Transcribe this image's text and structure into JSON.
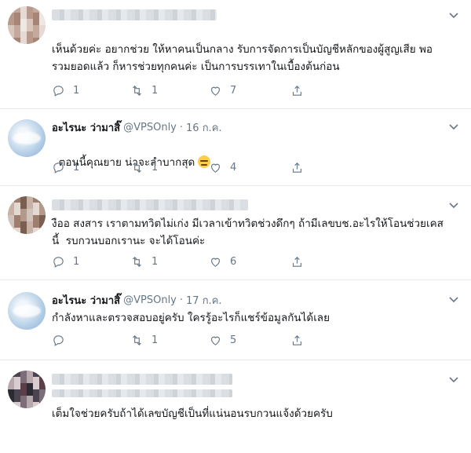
{
  "tweets": [
    {
      "display_name": "",
      "handle": "",
      "date": "",
      "text": "เห็นด้วยค่ะ อยากช่วย ให้หาคนเป็นกลาง รับการจัดการเป็นบัญชีหลักของผู้สูญเสีย พอ\nรวมยอดแล้ว ก็หารช่วยทุกคนค่ะ เป็นการบรรเทาในเบื้องต้นก่อน",
      "replies": "1",
      "retweets": "1",
      "likes": "7"
    },
    {
      "display_name": "อะไรนะ ว่ามาสิ๊",
      "handle": "@VPSOnly",
      "dot": "·",
      "date": "16 ก.ค.",
      "text": "ตอนนี้คุณยาย น่าจะลำบากสุด",
      "emoji": "expressionless-face",
      "replies": "1",
      "retweets": "1",
      "likes": "4"
    },
    {
      "display_name": "",
      "handle": "",
      "date": "",
      "text": "งืออ สงสาร เราตามทวิตไม่เก่ง มีเวลาเข้าทวิตช่วงดึกๆ ถ้ามีเลขบช.อะไรให้โอนช่วยเคส\nนี้  รบกวนบอกเรานะ จะได้โอนค่ะ",
      "replies": "1",
      "retweets": "1",
      "likes": "6"
    },
    {
      "display_name": "อะไรนะ ว่ามาสิ๊",
      "handle": "@VPSOnly",
      "dot": "·",
      "date": "17 ก.ค.",
      "text": "กำลังหาและตรวจสอบอยู่ครับ ใครรู้อะไรก็แชร์ข้อมูลกันได้เลย",
      "replies": "",
      "retweets": "1",
      "likes": "5"
    },
    {
      "display_name": "",
      "handle": "",
      "date": "",
      "text": "เต็มใจช่วยครับถ้าได้เลขบัญชีเป็นที่แน่นอนรบกวนแจ้งด้วยครับ"
    }
  ],
  "icons": {
    "reply": "reply-icon",
    "retweet": "retweet-icon",
    "like": "heart-icon",
    "share": "share-icon",
    "menu": "chevron-down-icon"
  },
  "colors": {
    "text": "#14171a",
    "secondary": "#657786",
    "divider": "#e6ecf0"
  }
}
